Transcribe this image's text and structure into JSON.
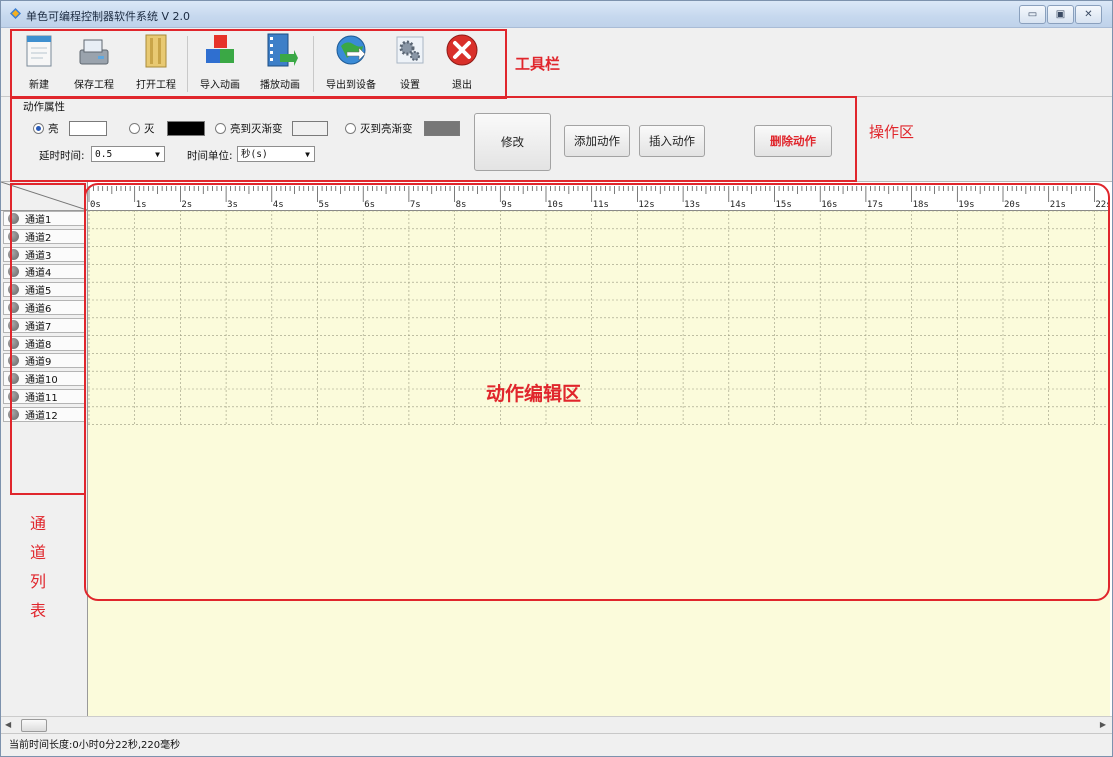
{
  "window": {
    "title": "单色可编程控制器软件系统 V 2.0",
    "min_glyph": "▭",
    "max_glyph": "▣",
    "close_glyph": "✕"
  },
  "toolbar": {
    "buttons": [
      {
        "label": "新建",
        "icon": "notepad-icon"
      },
      {
        "label": "保存工程",
        "icon": "disk-save-icon"
      },
      {
        "label": "打开工程",
        "icon": "folder-open-icon"
      },
      {
        "label": "导入动画",
        "icon": "color-blocks-icon"
      },
      {
        "label": "播放动画",
        "icon": "film-play-icon"
      },
      {
        "label": "导出到设备",
        "icon": "globe-export-icon"
      },
      {
        "label": "设置",
        "icon": "gears-icon"
      },
      {
        "label": "退出",
        "icon": "red-x-exit-icon"
      }
    ]
  },
  "annotations": {
    "toolbar": "工具栏",
    "ops": "操作区",
    "editor": "动作编辑区",
    "channels": [
      "通",
      "道",
      "列",
      "表"
    ]
  },
  "ops": {
    "group_title": "动作属性",
    "radios": [
      {
        "label": "亮",
        "selected": true,
        "swatch": "#ffffff"
      },
      {
        "label": "灭",
        "selected": false,
        "swatch": "#000000"
      },
      {
        "label": "亮到灭渐变",
        "selected": false,
        "swatch": "#f0f0f0"
      },
      {
        "label": "灭到亮渐变",
        "selected": false,
        "swatch": "#777777"
      }
    ],
    "delay_label": "延时时间:",
    "delay_value": "0.5",
    "unit_label": "时间单位:",
    "unit_value": "秒(s)",
    "modify": "修改",
    "add": "添加动作",
    "insert": "插入动作",
    "delete": "删除动作",
    "delete_color": "#e0262c"
  },
  "ruler_labels": [
    "0s",
    "1s",
    "2s",
    "3s",
    "4s",
    "5s",
    "6s",
    "7s",
    "8s",
    "9s",
    "10s",
    "11s",
    "12s",
    "13s",
    "14s",
    "15s",
    "16s",
    "17s",
    "18s",
    "19s",
    "20s",
    "21s",
    "22s"
  ],
  "channels": [
    "通道1",
    "通道2",
    "通道3",
    "通道4",
    "通道5",
    "通道6",
    "通道7",
    "通道8",
    "通道9",
    "通道10",
    "通道11",
    "通道12"
  ],
  "status": "当前时间长度:0小时0分22秒,220毫秒",
  "colors": {
    "annotation": "#e0262c",
    "timeline_bg": "#fbfbdb",
    "selected_radio": "#2a5bb8"
  }
}
